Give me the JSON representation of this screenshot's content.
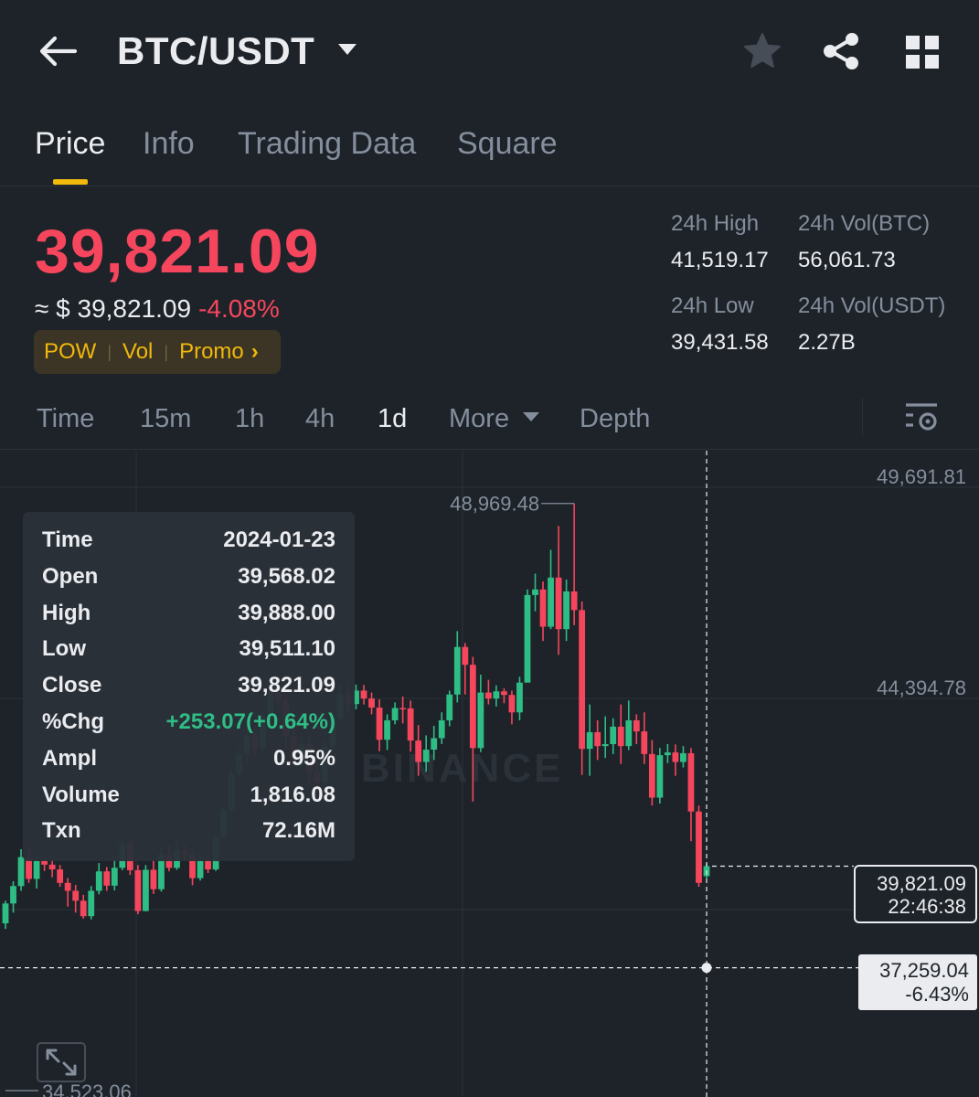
{
  "header": {
    "title": "BTC/USDT"
  },
  "tabs": [
    {
      "label": "Price",
      "active": true
    },
    {
      "label": "Info",
      "active": false
    },
    {
      "label": "Trading Data",
      "active": false
    },
    {
      "label": "Square",
      "active": false
    }
  ],
  "ticker": {
    "last_price": "39,821.09",
    "approx_usd": "≈ $ 39,821.09",
    "change_pct": "-4.08%",
    "tags": [
      "POW",
      "Vol",
      "Promo"
    ]
  },
  "stats": {
    "high_label": "24h High",
    "high_value": "41,519.17",
    "vol_btc_label": "24h Vol(BTC)",
    "vol_btc_value": "56,061.73",
    "low_label": "24h Low",
    "low_value": "39,431.58",
    "vol_usdt_label": "24h Vol(USDT)",
    "vol_usdt_value": "2.27B"
  },
  "timeframes": [
    {
      "label": "Time",
      "active": false
    },
    {
      "label": "15m",
      "active": false
    },
    {
      "label": "1h",
      "active": false
    },
    {
      "label": "4h",
      "active": false
    },
    {
      "label": "1d",
      "active": true
    },
    {
      "label": "More",
      "active": false
    },
    {
      "label": "Depth",
      "active": false
    }
  ],
  "tooltip": {
    "rows": [
      {
        "k": "Time",
        "v": "2024-01-23"
      },
      {
        "k": "Open",
        "v": "39,568.02"
      },
      {
        "k": "High",
        "v": "39,888.00"
      },
      {
        "k": "Low",
        "v": "39,511.10"
      },
      {
        "k": "Close",
        "v": "39,821.09"
      },
      {
        "k": "%Chg",
        "v": "+253.07(+0.64%)"
      },
      {
        "k": "Ampl",
        "v": "0.95%"
      },
      {
        "k": "Volume",
        "v": "1,816.08"
      },
      {
        "k": "Txn",
        "v": "72.16M"
      }
    ]
  },
  "chart_overlay": {
    "last_price": "39,821.09",
    "countdown": "22:46:38",
    "crosshair_price": "37,259.04",
    "crosshair_pct": "-6.43%",
    "watermark": "BINANCE"
  },
  "colors": {
    "up": "#2ebd85",
    "down": "#f6465d",
    "accent": "#f0b90b",
    "background": "#1e2329"
  },
  "chart_data": {
    "type": "candlestick",
    "y_axis_labels": [
      "49,691.81",
      "44,394.78"
    ],
    "ylim": [
      34000,
      50300
    ],
    "max_label": "48,969.48",
    "min_label": "34,523.06",
    "last_value": 39821.09,
    "crosshair_value": 37259.04,
    "candles": [
      [
        38380,
        38880,
        38240,
        38950
      ],
      [
        38880,
        39320,
        38650,
        39440
      ],
      [
        39320,
        40050,
        39200,
        40250
      ],
      [
        40050,
        39500,
        39400,
        40320
      ],
      [
        39500,
        39950,
        39260,
        40050
      ],
      [
        39950,
        39860,
        39700,
        40040
      ],
      [
        39860,
        39740,
        39540,
        39980
      ],
      [
        39740,
        39400,
        39300,
        39850
      ],
      [
        39400,
        39200,
        38800,
        39520
      ],
      [
        39200,
        38950,
        38650,
        39350
      ],
      [
        38950,
        38560,
        38500,
        39100
      ],
      [
        38560,
        39200,
        38480,
        39320
      ],
      [
        39200,
        39690,
        39110,
        39900
      ],
      [
        39690,
        39330,
        39200,
        39800
      ],
      [
        39330,
        39780,
        39210,
        40040
      ],
      [
        39780,
        40380,
        39720,
        40500
      ],
      [
        40380,
        39720,
        39600,
        40470
      ],
      [
        39720,
        38690,
        38610,
        39850
      ],
      [
        38690,
        39730,
        38680,
        39850
      ],
      [
        39730,
        39240,
        39120,
        39960
      ],
      [
        39240,
        40120,
        39180,
        40300
      ],
      [
        40120,
        39780,
        39690,
        40350
      ],
      [
        39780,
        40210,
        39730,
        40450
      ],
      [
        40210,
        40120,
        39980,
        40340
      ],
      [
        40120,
        39520,
        39340,
        40260
      ],
      [
        39520,
        39950,
        39460,
        40150
      ],
      [
        39950,
        39740,
        39650,
        40080
      ],
      [
        39740,
        40550,
        39700,
        40620
      ],
      [
        40550,
        41250,
        40500,
        41330
      ],
      [
        41250,
        42150,
        41180,
        42250
      ],
      [
        42150,
        42650,
        42010,
        42780
      ],
      [
        42650,
        43120,
        42380,
        43290
      ],
      [
        43120,
        42820,
        42600,
        43380
      ],
      [
        42820,
        43580,
        42700,
        43720
      ],
      [
        43580,
        44200,
        43500,
        44450
      ],
      [
        44200,
        43980,
        43850,
        44300
      ],
      [
        43980,
        43100,
        42750,
        44180
      ],
      [
        43100,
        42400,
        42200,
        43550
      ],
      [
        42400,
        42900,
        42350,
        43020
      ],
      [
        42900,
        42180,
        41850,
        43150
      ],
      [
        42180,
        41940,
        41600,
        42800
      ],
      [
        41940,
        42840,
        41720,
        43000
      ],
      [
        42840,
        43560,
        42700,
        43700
      ],
      [
        43560,
        44150,
        43450,
        44380
      ],
      [
        44150,
        43910,
        43700,
        44380
      ],
      [
        43910,
        44250,
        43780,
        44400
      ],
      [
        44250,
        44050,
        43900,
        44390
      ],
      [
        44050,
        43820,
        43650,
        44200
      ],
      [
        43820,
        43010,
        42720,
        44030
      ],
      [
        43010,
        43500,
        42750,
        43650
      ],
      [
        43500,
        43810,
        43400,
        43950
      ],
      [
        43810,
        43800,
        43420,
        44100
      ],
      [
        43800,
        42990,
        42710,
        44000
      ],
      [
        42990,
        42450,
        42100,
        43380
      ],
      [
        42450,
        42760,
        42200,
        43120
      ],
      [
        42760,
        43050,
        42500,
        43360
      ],
      [
        43050,
        43500,
        42900,
        43700
      ],
      [
        43500,
        44150,
        43350,
        44250
      ],
      [
        44150,
        45350,
        43950,
        45750
      ],
      [
        45350,
        44900,
        44150,
        45450
      ],
      [
        44900,
        42800,
        41450,
        45100
      ],
      [
        42800,
        44200,
        42700,
        44650
      ],
      [
        44200,
        44050,
        43900,
        44520
      ],
      [
        44050,
        44230,
        43850,
        44380
      ],
      [
        44230,
        44140,
        43930,
        44310
      ],
      [
        44140,
        43700,
        43400,
        44250
      ],
      [
        43700,
        44450,
        43500,
        44600
      ],
      [
        44450,
        46660,
        44500,
        46800
      ],
      [
        46660,
        46800,
        46250,
        47200
      ],
      [
        46800,
        45860,
        45500,
        47000
      ],
      [
        45860,
        47100,
        45800,
        47800
      ],
      [
        47100,
        45800,
        45150,
        48400
      ],
      [
        45800,
        46750,
        45500,
        47050
      ],
      [
        46750,
        46280,
        45900,
        48969
      ],
      [
        46280,
        42780,
        42120,
        46500
      ],
      [
        42780,
        43200,
        42100,
        43900
      ],
      [
        43200,
        42850,
        42500,
        43500
      ],
      [
        42850,
        42900,
        42550,
        43600
      ],
      [
        42900,
        43340,
        42650,
        43550
      ],
      [
        43340,
        42850,
        42400,
        43900
      ],
      [
        42850,
        43500,
        42750,
        44000
      ],
      [
        43500,
        43220,
        42900,
        43650
      ],
      [
        43220,
        42650,
        42400,
        43700
      ],
      [
        42650,
        41550,
        41350,
        43000
      ],
      [
        41550,
        42620,
        41400,
        42800
      ],
      [
        42620,
        42690,
        42420,
        42900
      ],
      [
        42690,
        42450,
        42100,
        42890
      ],
      [
        42450,
        42670,
        42310,
        42850
      ],
      [
        42670,
        41200,
        40450,
        42800
      ],
      [
        41200,
        39400,
        39300,
        41350
      ],
      [
        39568,
        39821,
        39511,
        39888
      ]
    ]
  }
}
